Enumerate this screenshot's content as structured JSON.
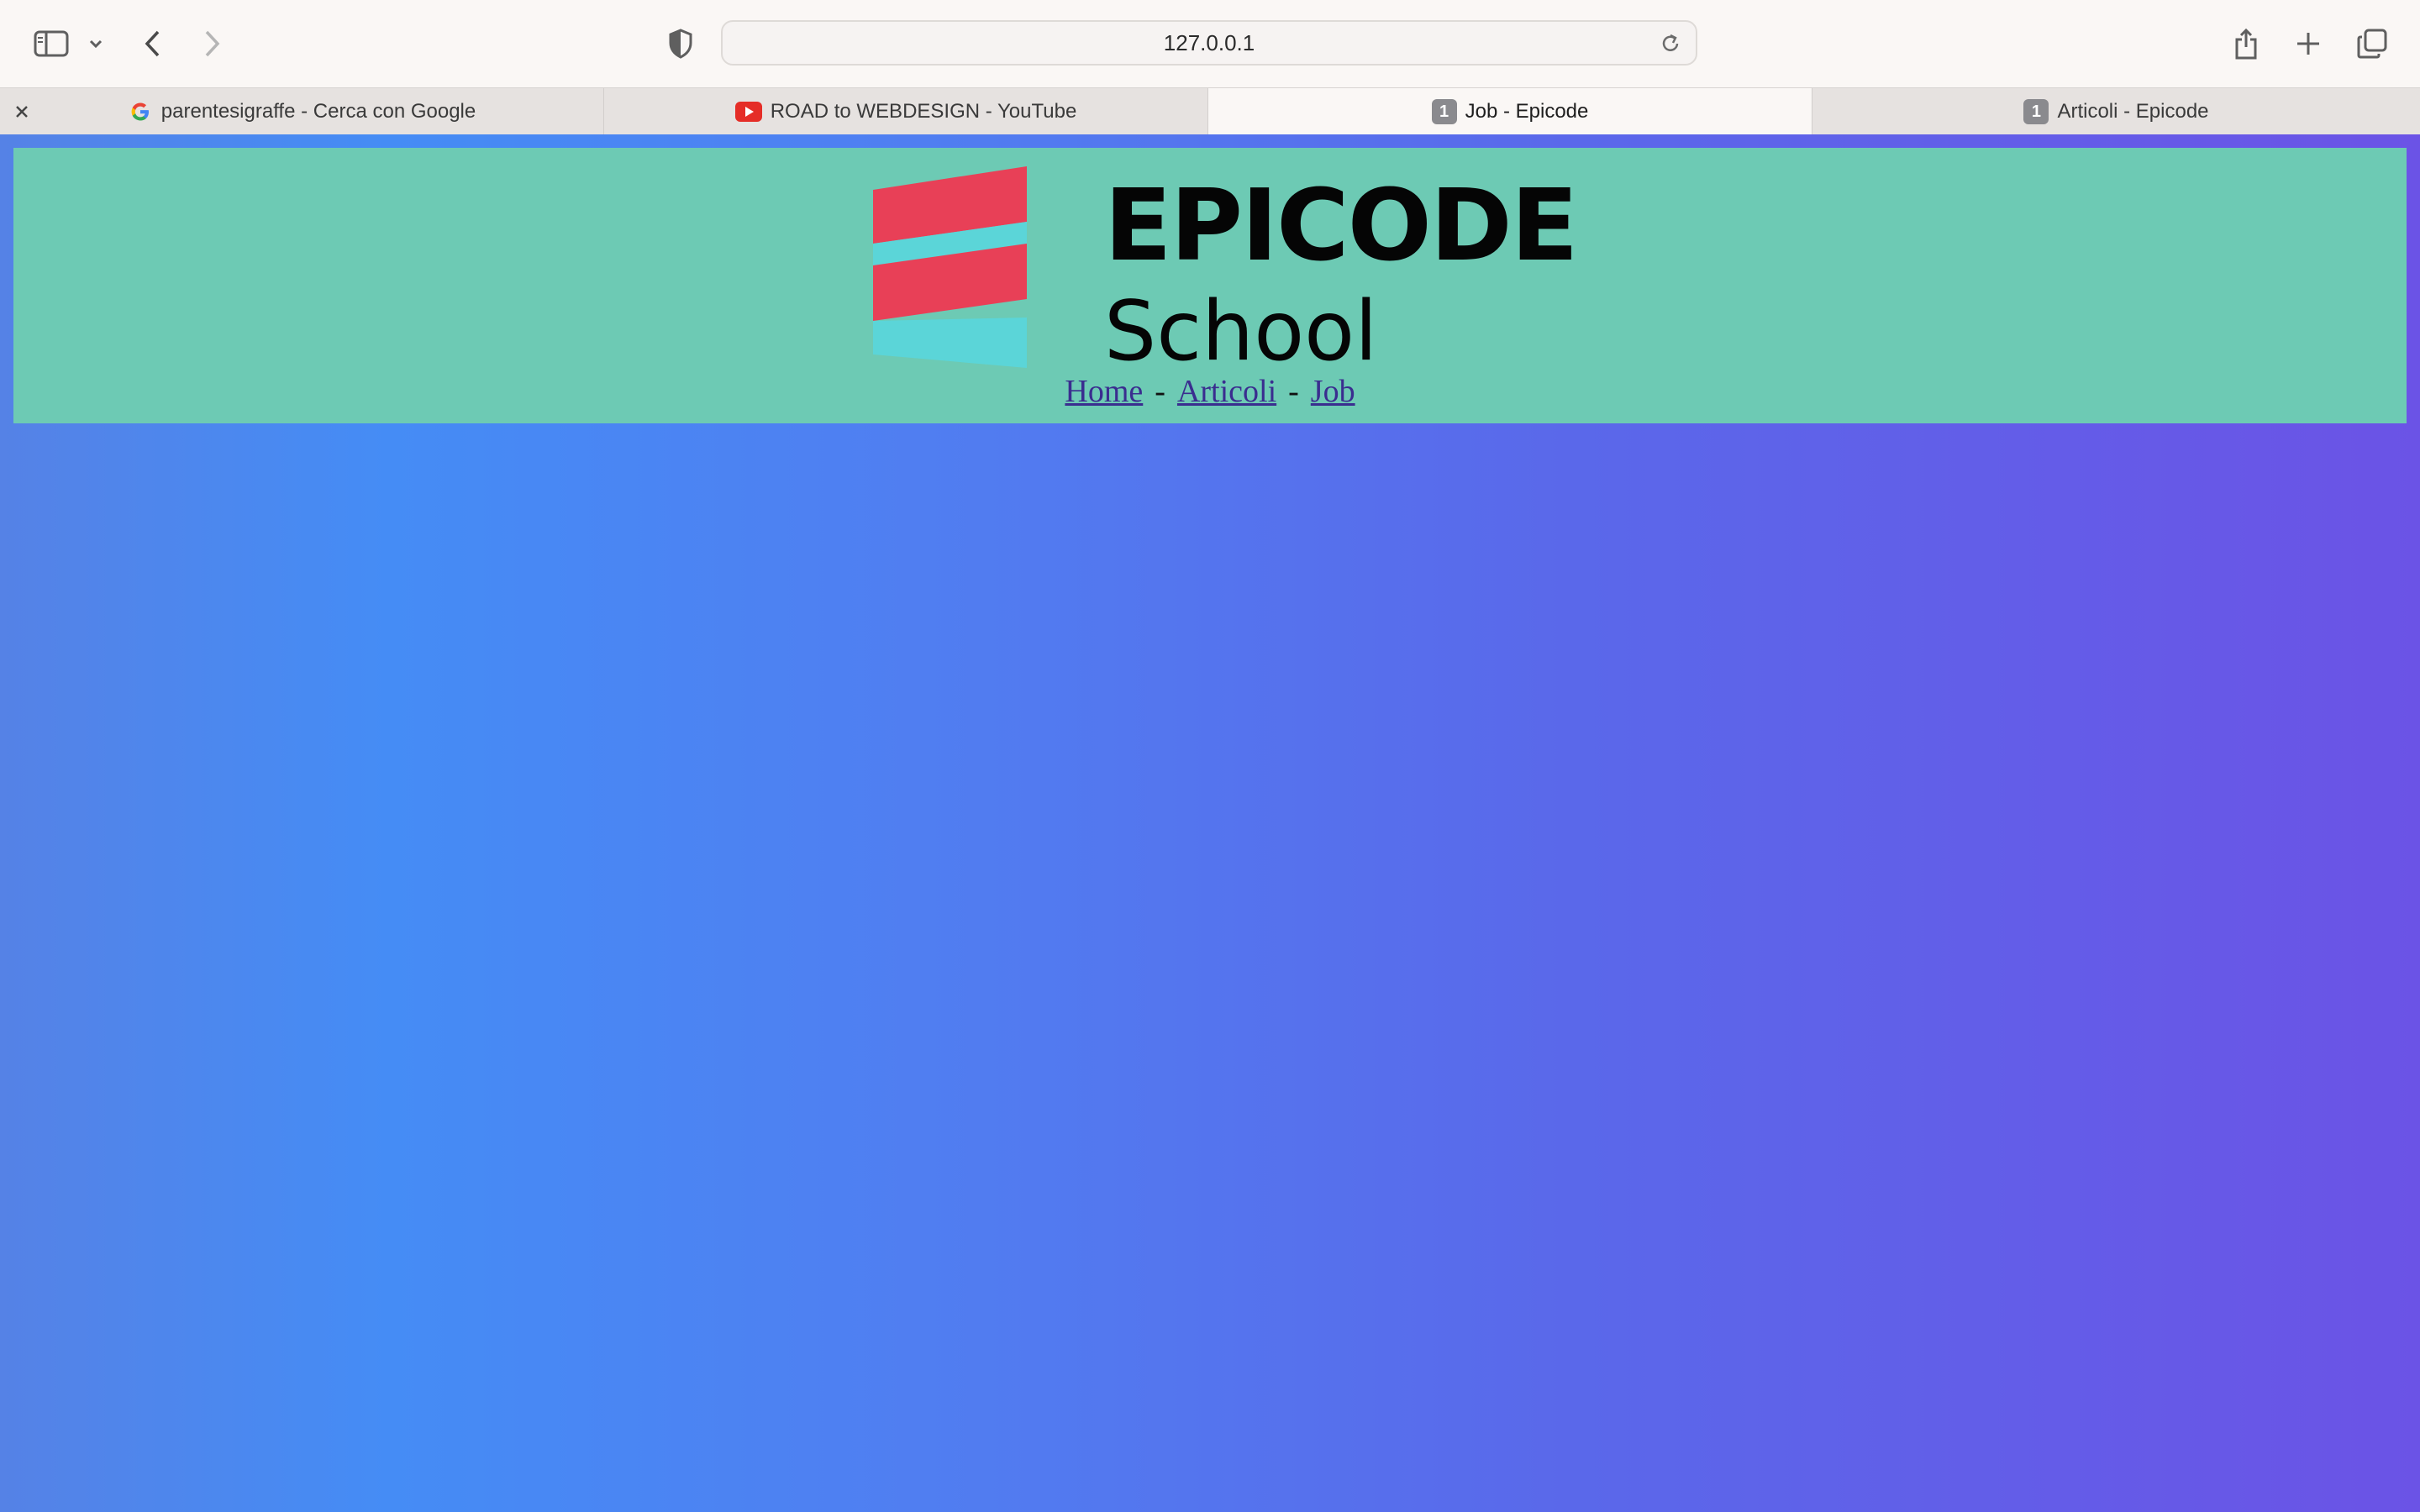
{
  "browser": {
    "url": "127.0.0.1",
    "tabs": [
      {
        "title": "parentesigraffe - Cerca con Google",
        "favicon": "google-icon"
      },
      {
        "title": "ROAD to WEBDESIGN - YouTube",
        "favicon": "youtube-icon"
      },
      {
        "title": "Job - Epicode",
        "favicon": "1",
        "active": true
      },
      {
        "title": "Articoli - Epicode",
        "favicon": "1"
      }
    ]
  },
  "page": {
    "brand_title": "EPICODE",
    "brand_subtitle": "School",
    "nav": [
      {
        "label": "Home"
      },
      {
        "label": "Articoli"
      },
      {
        "label": "Job"
      }
    ],
    "nav_separator": "-",
    "colors": {
      "header_bg": "#6dcab4",
      "logo_red": "#e84057",
      "logo_cyan": "#5bd5d8",
      "gradient_start": "#458cf5",
      "gradient_end": "#6b53e6"
    }
  }
}
